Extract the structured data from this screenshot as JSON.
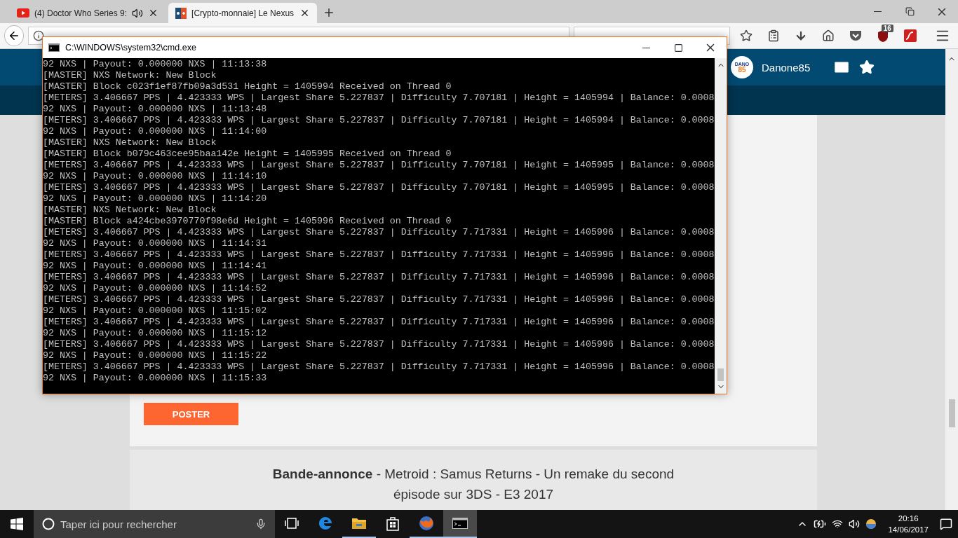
{
  "browser": {
    "tabs": [
      {
        "title": "(4) Doctor Who Series 9:",
        "selected": false,
        "audio": true
      },
      {
        "title": "[Crypto-monnaie] Le Nexus",
        "selected": true,
        "audio": false
      }
    ],
    "addon_badge": "16"
  },
  "page": {
    "avatar_text": "DANO",
    "avatar_number": "85",
    "username": "Danone85",
    "post_button": "POSTER",
    "trailer": "**Bande-annonce** - Metroid : Samus Returns - Un remake du second épisode sur 3DS - E3 2017"
  },
  "console": {
    "title": "C:\\WINDOWS\\system32\\cmd.exe",
    "lines": [
      "92 NXS | Payout: 0.000000 NXS | 11:13:38",
      "[MASTER] NXS Network: New Block",
      "[MASTER] Block c023f1ef87fb09a3d531 Height = 1405994 Received on Thread 0",
      "[METERS] 3.406667 PPS | 4.423333 WPS | Largest Share 5.227837 | Difficulty 7.707181 | Height = 1405994 | Balance: 0.0008",
      "92 NXS | Payout: 0.000000 NXS | 11:13:48",
      "[METERS] 3.406667 PPS | 4.423333 WPS | Largest Share 5.227837 | Difficulty 7.707181 | Height = 1405994 | Balance: 0.0008",
      "92 NXS | Payout: 0.000000 NXS | 11:14:00",
      "[MASTER] NXS Network: New Block",
      "[MASTER] Block b079c463cee95baa142e Height = 1405995 Received on Thread 0",
      "[METERS] 3.406667 PPS | 4.423333 WPS | Largest Share 5.227837 | Difficulty 7.707181 | Height = 1405995 | Balance: 0.0008",
      "92 NXS | Payout: 0.000000 NXS | 11:14:10",
      "[METERS] 3.406667 PPS | 4.423333 WPS | Largest Share 5.227837 | Difficulty 7.707181 | Height = 1405995 | Balance: 0.0008",
      "92 NXS | Payout: 0.000000 NXS | 11:14:20",
      "[MASTER] NXS Network: New Block",
      "[MASTER] Block a424cbe3970770f98e6d Height = 1405996 Received on Thread 0",
      "[METERS] 3.406667 PPS | 4.423333 WPS | Largest Share 5.227837 | Difficulty 7.717331 | Height = 1405996 | Balance: 0.0008",
      "92 NXS | Payout: 0.000000 NXS | 11:14:31",
      "[METERS] 3.406667 PPS | 4.423333 WPS | Largest Share 5.227837 | Difficulty 7.717331 | Height = 1405996 | Balance: 0.0008",
      "92 NXS | Payout: 0.000000 NXS | 11:14:41",
      "[METERS] 3.406667 PPS | 4.423333 WPS | Largest Share 5.227837 | Difficulty 7.717331 | Height = 1405996 | Balance: 0.0008",
      "92 NXS | Payout: 0.000000 NXS | 11:14:52",
      "[METERS] 3.406667 PPS | 4.423333 WPS | Largest Share 5.227837 | Difficulty 7.717331 | Height = 1405996 | Balance: 0.0008",
      "92 NXS | Payout: 0.000000 NXS | 11:15:02",
      "[METERS] 3.406667 PPS | 4.423333 WPS | Largest Share 5.227837 | Difficulty 7.717331 | Height = 1405996 | Balance: 0.0008",
      "92 NXS | Payout: 0.000000 NXS | 11:15:12",
      "[METERS] 3.406667 PPS | 4.423333 WPS | Largest Share 5.227837 | Difficulty 7.717331 | Height = 1405996 | Balance: 0.0008",
      "92 NXS | Payout: 0.000000 NXS | 11:15:22",
      "[METERS] 3.406667 PPS | 4.423333 WPS | Largest Share 5.227837 | Difficulty 7.717331 | Height = 1405996 | Balance: 0.0008",
      "92 NXS | Payout: 0.000000 NXS | 11:15:33"
    ]
  },
  "taskbar": {
    "search_placeholder": "Taper ici pour rechercher",
    "apps": [
      {
        "kind": "taskview",
        "running": false,
        "selected": false
      },
      {
        "kind": "edge",
        "running": false,
        "selected": false
      },
      {
        "kind": "explorer",
        "running": true,
        "selected": false
      },
      {
        "kind": "store",
        "running": false,
        "selected": false
      },
      {
        "kind": "firefox",
        "running": true,
        "selected": false
      },
      {
        "kind": "console",
        "running": true,
        "selected": true
      }
    ],
    "time": "20:16",
    "date": "14/06/2017"
  }
}
